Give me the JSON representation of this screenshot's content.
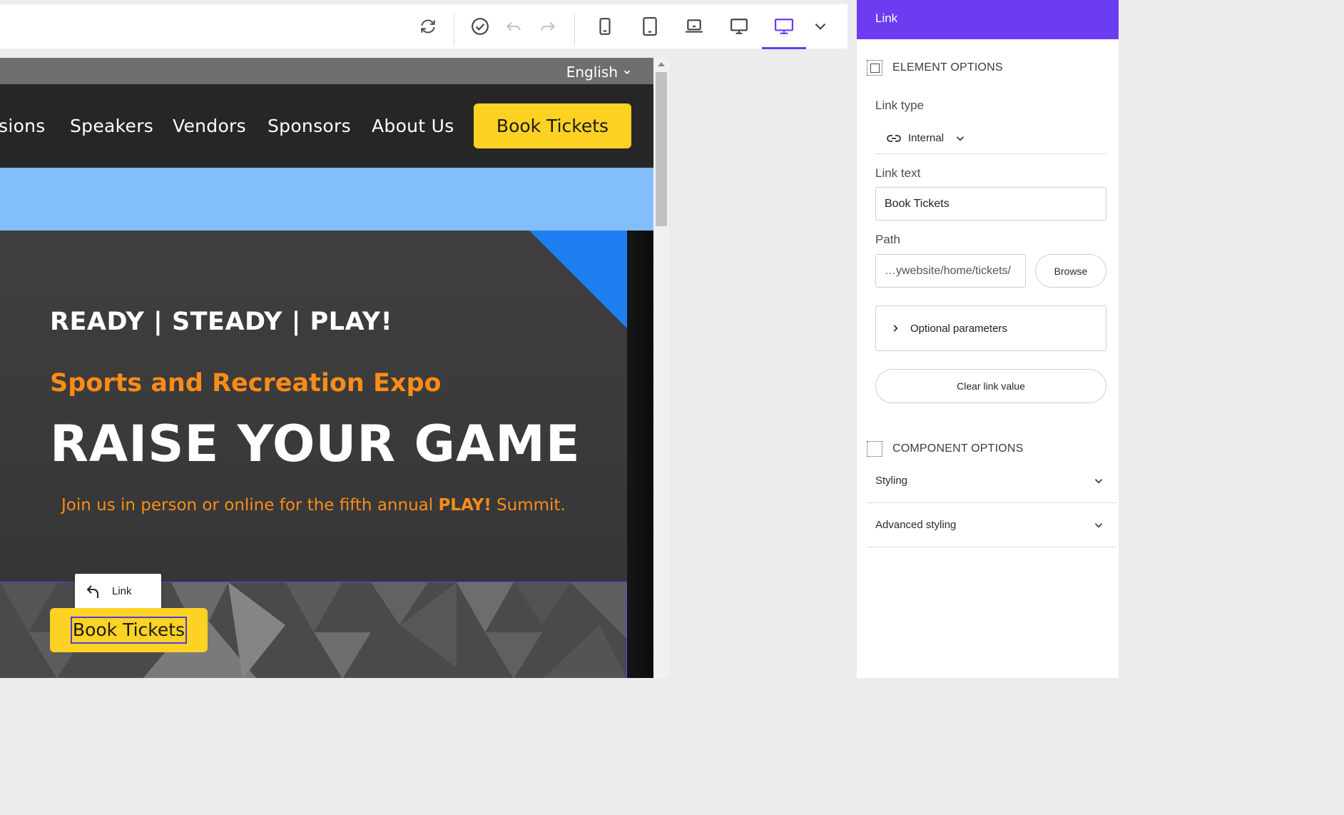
{
  "toolbar": {
    "icons": [
      "refresh-icon",
      "check-circle-icon",
      "undo-icon",
      "redo-icon",
      "mobile-icon",
      "tablet-icon",
      "laptop-icon",
      "monitor-icon",
      "desktop-icon",
      "chevron-down-icon"
    ],
    "active_device": "desktop",
    "accent": "#6b3cf0"
  },
  "site": {
    "language": "English",
    "nav": [
      "sions",
      "Speakers",
      "Vendors",
      "Sponsors",
      "About Us"
    ],
    "nav_cta": "Book Tickets",
    "eyebrow": "READY | STEADY | PLAY!",
    "subhead": "Sports and Recreation Expo",
    "headline": "RAISE YOUR GAME",
    "tagline_pre": "Join us in person or online for the fifth annual ",
    "tagline_bold": "PLAY!",
    "tagline_post": " Summit.",
    "link_chip_label": "Link",
    "hero_cta": "Book Tickets",
    "colors": {
      "cta": "#fdd223",
      "orange": "#fb8c18",
      "blue_band": "#82bdfc",
      "corner": "#1e7ff2"
    }
  },
  "panel": {
    "title": "Link",
    "element_options": "ELEMENT OPTIONS",
    "link_type_label": "Link type",
    "link_type_value": "Internal",
    "link_text_label": "Link text",
    "link_text_value": "Book Tickets",
    "path_label": "Path",
    "path_value": "…ywebsite/home/tickets/",
    "browse": "Browse",
    "optional_parameters": "Optional parameters",
    "clear_link": "Clear link value",
    "component_options": "COMPONENT OPTIONS",
    "styling": "Styling",
    "advanced_styling": "Advanced styling"
  }
}
